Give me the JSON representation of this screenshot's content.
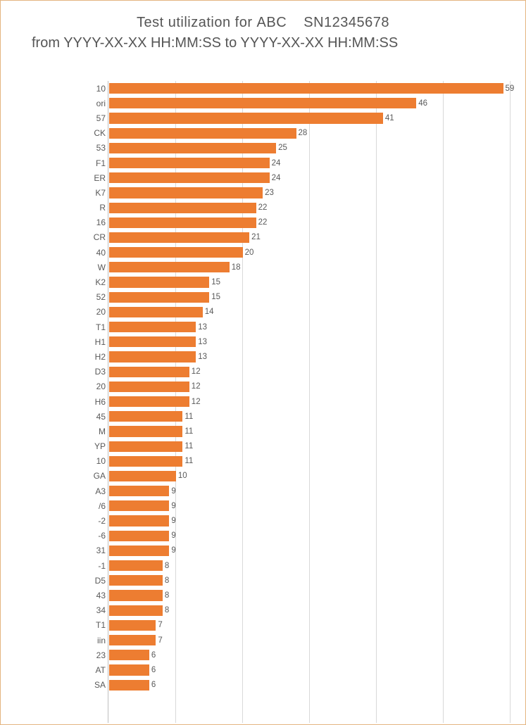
{
  "title": {
    "line1_prefix": "Test utilization for",
    "device": "ABC",
    "sn_label": "SN",
    "sn_value": "12345678",
    "line2_prefix": "from",
    "from": "YYYY-XX-XX HH:MM:SS",
    "mid": "to",
    "to": "YYYY-XX-XX HH:MM:SS"
  },
  "chart_data": {
    "type": "bar",
    "orientation": "horizontal",
    "title": "Test utilization for ABC SN 12345678 from YYYY-XX-XX HH:MM:SS to YYYY-XX-XX HH:MM:SS",
    "xlabel": "",
    "ylabel": "",
    "xlim": [
      0,
      60
    ],
    "x_gridlines": [
      0,
      10,
      20,
      30,
      40,
      50,
      60
    ],
    "categories": [
      "10",
      "ori",
      "57",
      "CK",
      "53",
      "F1",
      "ER",
      "K7",
      "R",
      "16",
      "CR",
      "40",
      "W",
      "K2",
      "52",
      "20",
      "T1",
      "H1",
      "H2",
      "D3",
      "20",
      "H6",
      "45",
      "M",
      "YP",
      "10",
      "GA",
      "A3",
      "/6",
      "-2",
      "-6",
      "31",
      "-1",
      "D5",
      "43",
      "34",
      "T1",
      "iin",
      "23",
      "AT",
      "SA"
    ],
    "values": [
      59,
      46,
      41,
      28,
      25,
      24,
      24,
      23,
      22,
      22,
      21,
      20,
      18,
      15,
      15,
      14,
      13,
      13,
      13,
      12,
      12,
      12,
      11,
      11,
      11,
      11,
      10,
      9,
      9,
      9,
      9,
      9,
      8,
      8,
      8,
      8,
      7,
      7,
      6,
      6,
      6
    ],
    "bar_color": "#ED7D31",
    "grid_color": "#d9d9d9",
    "text_color": "#595959"
  }
}
